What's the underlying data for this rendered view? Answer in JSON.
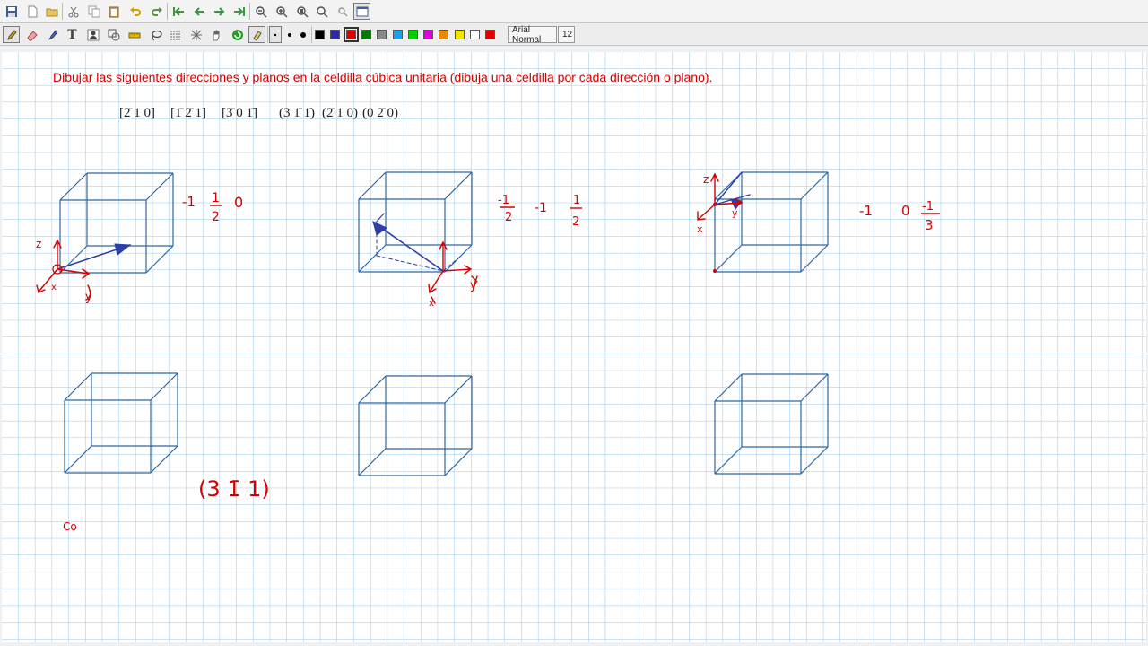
{
  "toolbar_top": {
    "buttons": [
      "save-icon",
      "new-page-icon",
      "open-folder-icon",
      "cut-icon",
      "copy-icon",
      "paste-icon",
      "undo-icon",
      "redo-icon",
      "first-page-icon",
      "previous-page-icon",
      "next-page-icon",
      "last-page-icon",
      "zoom-out-icon",
      "zoom-in-icon",
      "zoom-fit-icon",
      "zoom-actual-icon",
      "zoom-small-icon",
      "fullscreen-icon"
    ]
  },
  "toolbar_tools": {
    "tools": [
      "pen-icon",
      "eraser-icon",
      "highlighter-icon",
      "text-tool-icon",
      "user-icon",
      "shapes-icon",
      "ruler-icon",
      "lasso-icon",
      "pattern-icon",
      "grid-icon",
      "hand-icon",
      "refresh-icon",
      "fill-icon"
    ],
    "colors": [
      "#000000",
      "#2a2aa8",
      "#e00000",
      "#007a00",
      "#888888",
      "#1aa0e6",
      "#00d000",
      "#e000e0",
      "#e88a00",
      "#f2e600",
      "#ffffff",
      "#e00000"
    ],
    "font_name": "Arial Normal",
    "font_size": "12"
  },
  "board": {
    "instruction": "Dibujar las siguientes direcciones y planos en la celdilla cúbica unitaria (dibuja una celdilla por cada dirección o plano).",
    "notations": [
      "[2̄ 1 0]",
      "[1̄ 2̄ 1]",
      "[3̄ 0 1̄]",
      "(3 1̄ 1̄)",
      "(2̄ 1 0)",
      "(0 2̄ 0)"
    ],
    "handwriting": {
      "coords_1": [
        "-1",
        "1",
        "2",
        "0"
      ],
      "coords_2": [
        "-1",
        "2",
        "-1",
        "1",
        "2"
      ],
      "coords_3": [
        "-1",
        "0",
        "-1",
        "3"
      ],
      "plane_label": "(3 1̄ 1)",
      "axis_z": "z",
      "axis_x": "x",
      "axis_y": "y",
      "scribble": "Co"
    },
    "ink_colors": {
      "red": "#d40000",
      "blue": "#2c3fa8",
      "cube": "#2e67a0",
      "grid": "#9cc7e6"
    }
  }
}
